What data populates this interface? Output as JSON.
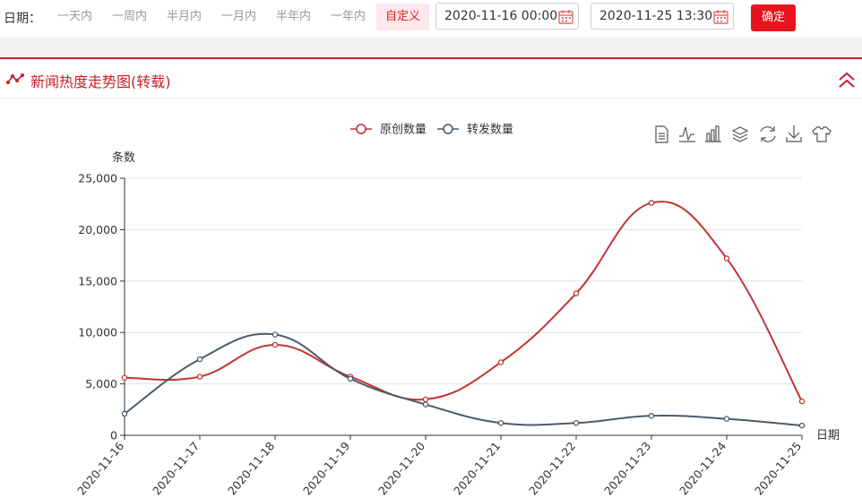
{
  "filter": {
    "date_label": "日期：",
    "ranges": [
      "一天内",
      "一周内",
      "半月内",
      "一月内",
      "半年内",
      "一年内",
      "自定义"
    ],
    "active_range": "自定义",
    "start_date": "2020-11-16 00:00",
    "end_date": "2020-11-25 13:30",
    "confirm_label": "确定"
  },
  "panel": {
    "title": "新闻热度走势图(转载)"
  },
  "colors": {
    "accent": "#d11c25",
    "series_original": "#c23531",
    "series_repost": "#4b5b6b"
  },
  "toolbox_icons": [
    "data-view-icon",
    "line-chart-icon",
    "bar-chart-icon",
    "stack-icon",
    "restore-icon",
    "download-icon",
    "theme-icon"
  ],
  "chart_data": {
    "type": "line",
    "title": "",
    "xlabel": "日期",
    "ylabel": "条数",
    "categories": [
      "2020-11-16",
      "2020-11-17",
      "2020-11-18",
      "2020-11-19",
      "2020-11-20",
      "2020-11-21",
      "2020-11-22",
      "2020-11-23",
      "2020-11-24",
      "2020-11-25"
    ],
    "series": [
      {
        "name": "原创数量",
        "color": "#c23531",
        "values": [
          5600,
          5700,
          8800,
          5700,
          3500,
          7100,
          13800,
          22600,
          17200,
          3300
        ]
      },
      {
        "name": "转发数量",
        "color": "#4b5b6b",
        "values": [
          2100,
          7400,
          9800,
          5500,
          3000,
          1200,
          1200,
          1900,
          1600,
          950
        ]
      }
    ],
    "ylim": [
      0,
      25000
    ],
    "yticks": [
      "0",
      "5,000",
      "10,000",
      "15,000",
      "20,000",
      "25,000"
    ],
    "grid": true,
    "smooth": true,
    "legend_position": "top-center"
  }
}
